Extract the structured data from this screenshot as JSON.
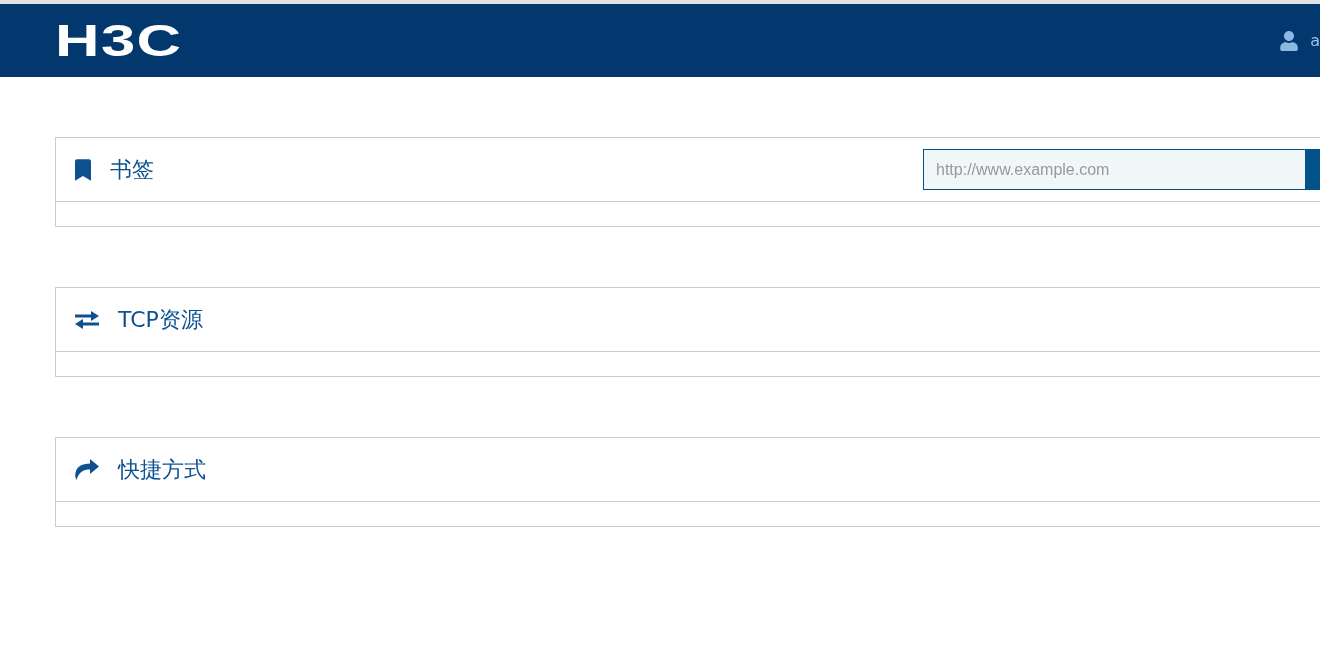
{
  "header": {
    "logo": "H3C",
    "user": {
      "name": "a"
    }
  },
  "panels": [
    {
      "kind": "bookmarks",
      "title": "书签",
      "search": {
        "placeholder": "http://www.example.com"
      }
    },
    {
      "kind": "tcp_resources",
      "title": "TCP资源"
    },
    {
      "kind": "shortcuts",
      "title": "快捷方式"
    }
  ]
}
